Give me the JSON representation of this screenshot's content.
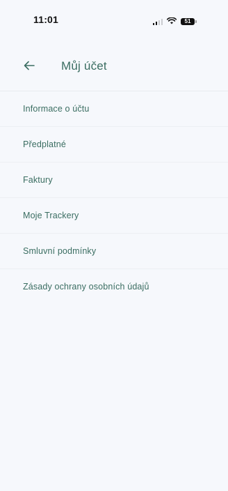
{
  "status_bar": {
    "time": "11:01",
    "battery": "51"
  },
  "header": {
    "back_icon": "arrow-left-icon",
    "title": "Můj účet"
  },
  "menu": {
    "items": [
      {
        "label": "Informace o účtu"
      },
      {
        "label": "Předplatné"
      },
      {
        "label": "Faktury"
      },
      {
        "label": "Moje Trackery"
      },
      {
        "label": "Smluvní podmínky"
      },
      {
        "label": "Zásady ochrany osobních údajů"
      }
    ]
  },
  "colors": {
    "accent": "#3a6d61",
    "background": "#f6f8fc"
  }
}
